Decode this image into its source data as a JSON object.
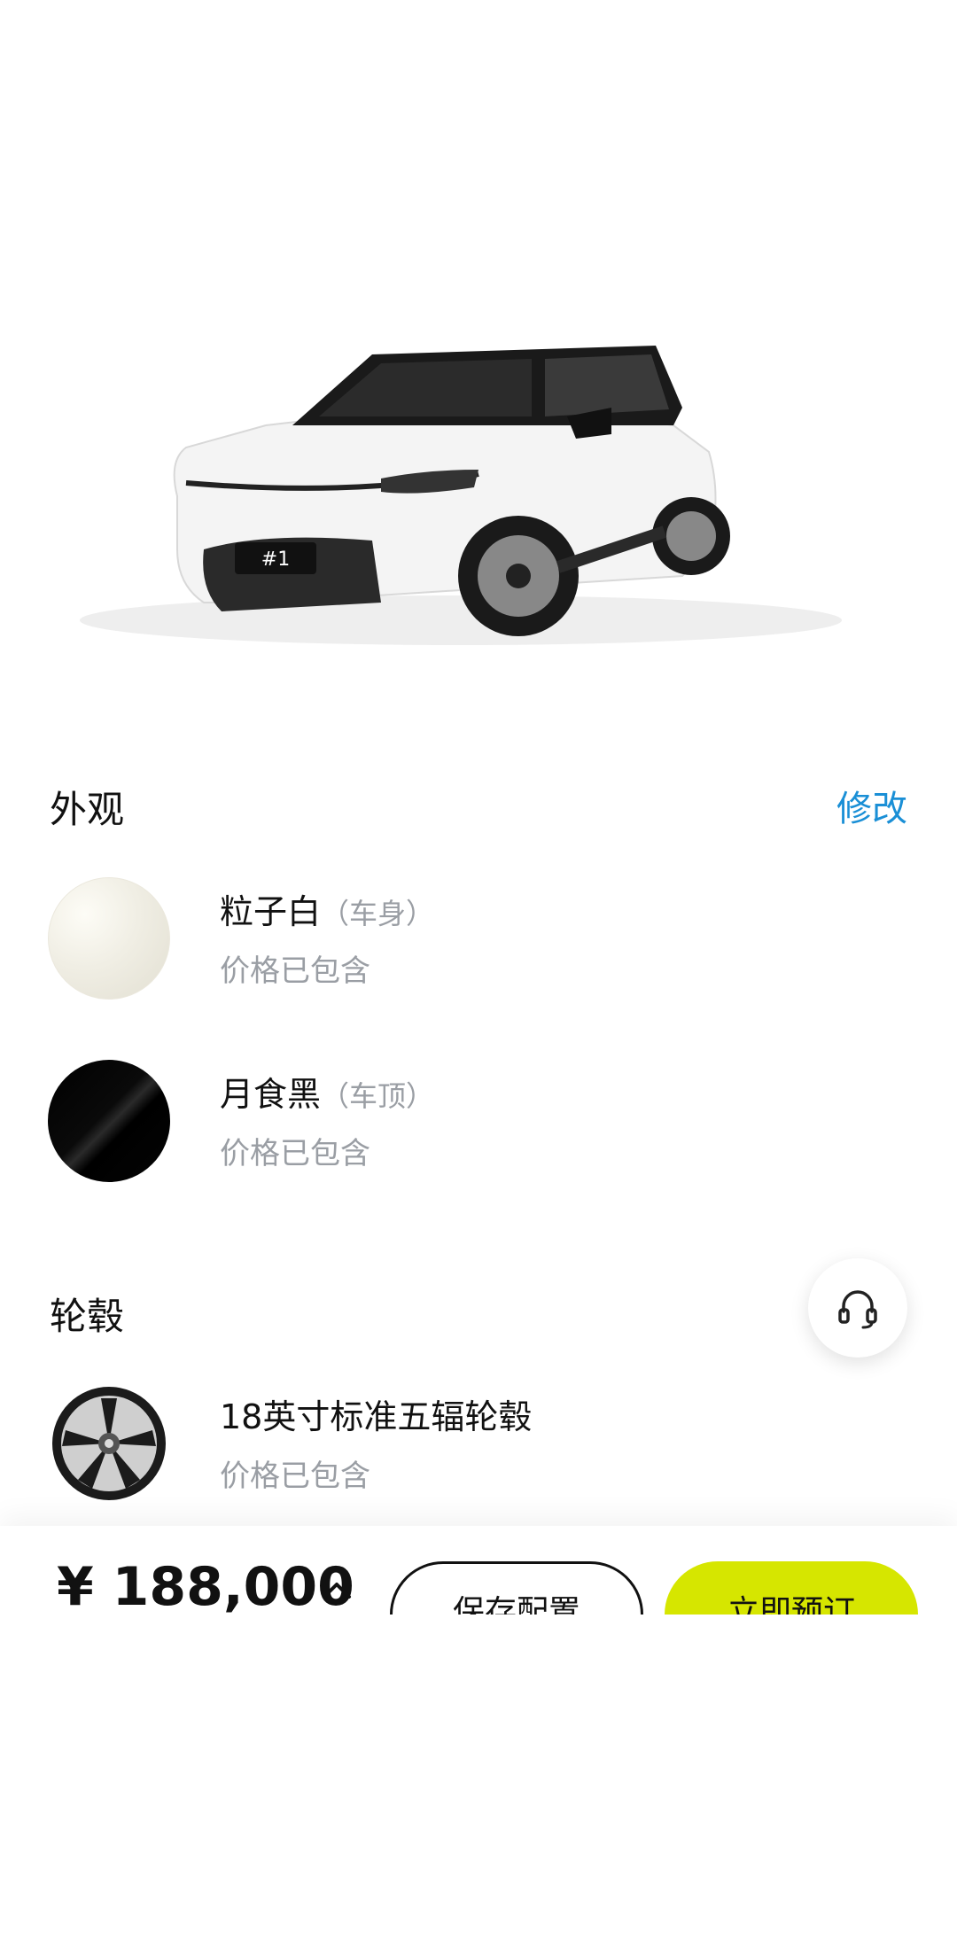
{
  "exterior": {
    "title": "外观",
    "edit_label": "修改",
    "options": [
      {
        "name": "粒子白",
        "sub": "（车身）",
        "price_note": "价格已包含"
      },
      {
        "name": "月食黑",
        "sub": "（车顶）",
        "price_note": "价格已包含"
      }
    ]
  },
  "wheels": {
    "title": "轮毂",
    "options": [
      {
        "name": "18英寸标准五辐轮毂",
        "price_note": "价格已包含"
      }
    ]
  },
  "footer": {
    "price": "¥ 188,000",
    "save_label": "保存配置",
    "order_label": "立即预订"
  },
  "colors": {
    "accent_link": "#1a8fd6",
    "order_button": "#d6e600",
    "muted_text": "#9a9ea4"
  },
  "icons": {
    "customer_service": "headset-icon",
    "price_toggle": "chevron-up-icon"
  }
}
